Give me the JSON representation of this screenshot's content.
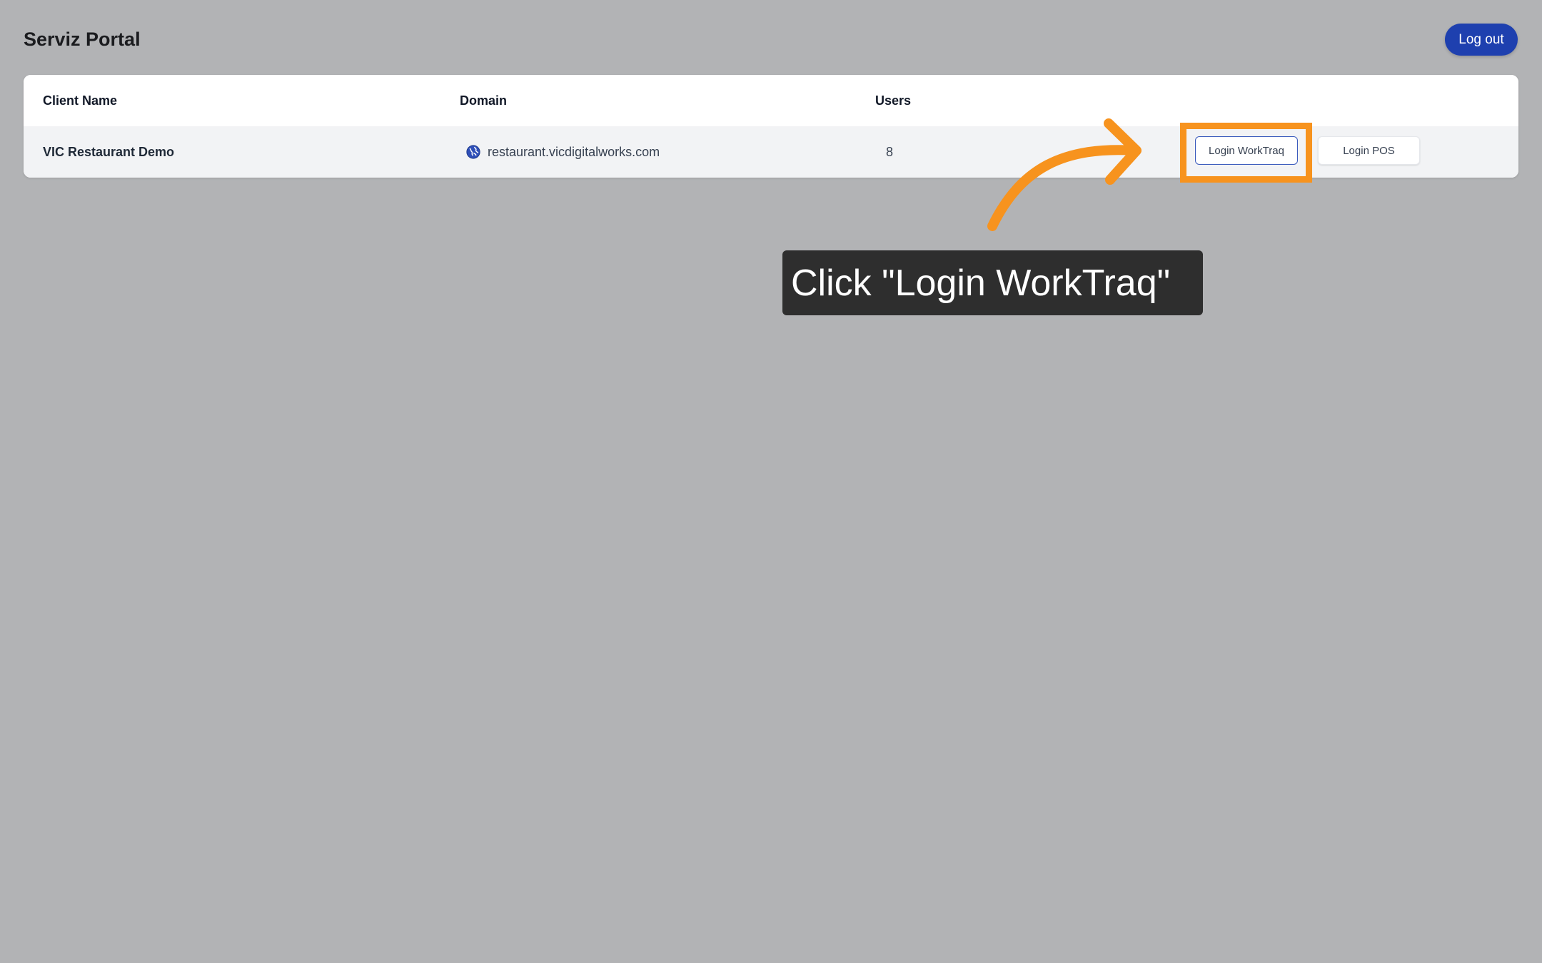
{
  "header": {
    "title": "Serviz Portal",
    "logout_label": "Log out"
  },
  "table": {
    "columns": {
      "client_name": "Client Name",
      "domain": "Domain",
      "users": "Users"
    },
    "rows": [
      {
        "client_name": "VIC Restaurant Demo",
        "domain": "restaurant.vicdigitalworks.com",
        "users": "8",
        "login_worktraq_label": "Login WorkTraq",
        "login_pos_label": "Login POS"
      }
    ]
  },
  "annotation": {
    "callout_text": "Click \"Login WorkTraq\"",
    "highlight_color": "#f7931e"
  },
  "colors": {
    "background": "#b2b3b5",
    "accent": "#1e40af",
    "callout_bg": "#2e2e2e"
  }
}
